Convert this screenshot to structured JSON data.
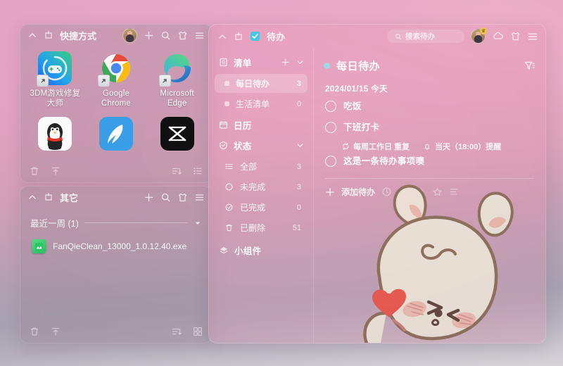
{
  "desktop": {
    "background_top": "#e9a5c4",
    "background_bottom": "#dcdbdf"
  },
  "shortcuts_panel": {
    "title": "快捷方式",
    "header_icons": [
      "collapse-chevron-icon",
      "pin-icon",
      "avatar-icon",
      "add-icon",
      "search-icon",
      "shirt-icon",
      "menu-icon"
    ],
    "footer_icons": [
      "trash-icon",
      "upload-icon",
      "sort-icon",
      "list-view-icon"
    ],
    "apps": [
      {
        "label": "3DM游戏修复大师",
        "icon": "gamepad-icon",
        "color_a": "#2fd17a",
        "color_b": "#1357ff"
      },
      {
        "label": "Google Chrome",
        "icon": "chrome-icon",
        "color_a": "#ea4335",
        "color_b": "#4285f4"
      },
      {
        "label": "Microsoft Edge",
        "icon": "edge-icon",
        "color_a": "#3ccbd9",
        "color_b": "#0f6cbd"
      },
      {
        "label": "",
        "icon": "qq-penguin-icon",
        "color_a": "#ffffff",
        "color_b": "#eeeeee"
      },
      {
        "label": "",
        "icon": "blue-wing-icon",
        "color_a": "#2f9ce8",
        "color_b": "#1a7fd4"
      },
      {
        "label": "",
        "icon": "capcut-icon",
        "color_a": "#141414",
        "color_b": "#000000"
      }
    ]
  },
  "other_panel": {
    "title": "其它",
    "header_icons": [
      "collapse-chevron-icon",
      "pin-icon",
      "add-icon",
      "search-icon",
      "shirt-icon",
      "menu-icon"
    ],
    "group": {
      "label": "最近一周 (1)",
      "chevron": "chevron-down-icon"
    },
    "files": [
      {
        "name": "FanQieClean_13000_1.0.12.40.exe",
        "icon": "exe-file-icon"
      }
    ],
    "footer_icons": [
      "trash-icon",
      "upload-icon",
      "sort-icon",
      "grid-view-icon"
    ]
  },
  "todo_window": {
    "title": "待办",
    "app_icon": "checkbox-checked-icon",
    "accent": "#3fc9e0",
    "header_icons": [
      "collapse-chevron-icon",
      "pin-icon",
      "avatar-icon",
      "cloud-icon",
      "shirt-icon",
      "menu-icon"
    ],
    "search": {
      "placeholder": "搜索待办",
      "icon": "search-icon"
    },
    "sidebar": {
      "sections": [
        {
          "name": "清单",
          "icon": "list-section-icon",
          "actions": [
            "add-icon",
            "chevron-down-icon"
          ],
          "items": [
            {
              "label": "每日待办",
              "count": "3",
              "active": true
            },
            {
              "label": "生活清单",
              "count": "0",
              "active": false
            }
          ]
        },
        {
          "name": "日历",
          "icon": "calendar-icon",
          "actions": [],
          "items": []
        },
        {
          "name": "状态",
          "icon": "status-icon",
          "actions": [
            "chevron-down-icon"
          ],
          "items": [
            {
              "label": "全部",
              "count": "3",
              "icon": "all-list-icon"
            },
            {
              "label": "未完成",
              "count": "3",
              "icon": "circle-icon"
            },
            {
              "label": "已完成",
              "count": "0",
              "icon": "check-circle-icon"
            },
            {
              "label": "已删除",
              "count": "51",
              "icon": "trash-icon"
            }
          ]
        },
        {
          "name": "小组件",
          "icon": "widget-icon",
          "actions": [],
          "items": []
        }
      ]
    },
    "main": {
      "list_title": "每日待办",
      "filter_icon": "filter-icon",
      "date_label": "2024/01/15  今天",
      "tasks": [
        {
          "name": "吃饭",
          "done": false,
          "meta": []
        },
        {
          "name": "下班打卡",
          "done": false,
          "meta": [
            {
              "icon": "repeat-icon",
              "text": "每周工作日  重复"
            },
            {
              "icon": "bell-icon",
              "text": "当天（18:00）提醒"
            }
          ]
        },
        {
          "name": "这是一条待办事项噢",
          "done": false,
          "meta": []
        }
      ],
      "add_row": {
        "label": "添加待办",
        "plus_icon": "plus-icon",
        "icons": [
          "clock-icon",
          "flag-icon",
          "bell-icon",
          "star-icon",
          "more-icon"
        ]
      },
      "illustration": "bunny-kiss-heart-illustration"
    }
  }
}
